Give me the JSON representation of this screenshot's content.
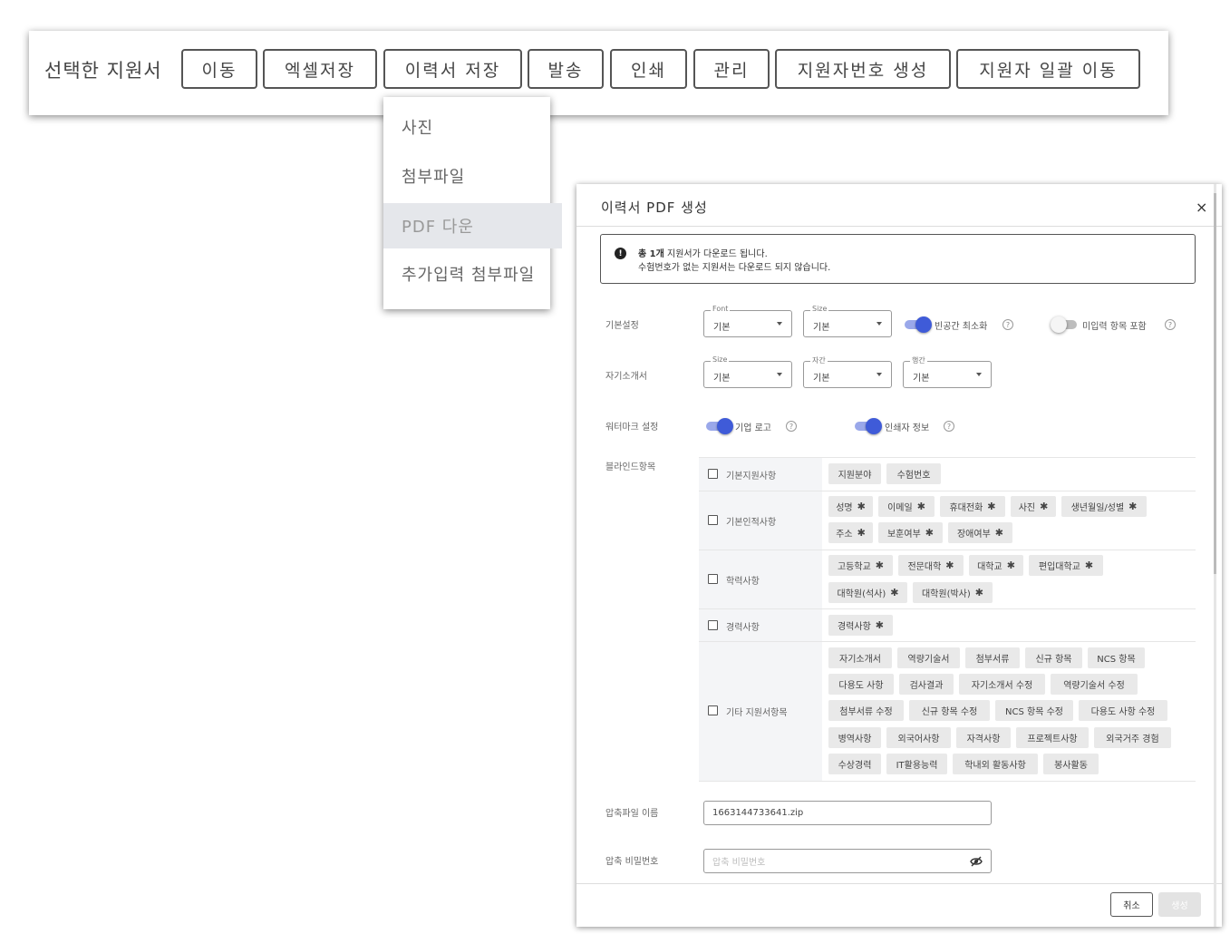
{
  "toolbar": {
    "title": "선택한 지원서",
    "buttons": [
      "이동",
      "엑셀저장",
      "이력서 저장",
      "발송",
      "인쇄",
      "관리",
      "지원자번호 생성",
      "지원자 일괄 이동"
    ]
  },
  "dropdown": {
    "items": [
      "사진",
      "첨부파일",
      "PDF 다운",
      "추가입력 첨부파일"
    ],
    "active_item": "PDF 다운"
  },
  "modal": {
    "title": "이력서 PDF 생성",
    "close": "×",
    "notice": {
      "icon": "info-icon",
      "line1_bold": "총 1개",
      "line1_rest": " 지원서가 다운로드 됩니다.",
      "line2": "수험번호가 없는 지원서는 다운로드 되지 않습니다."
    },
    "basic": {
      "label": "기본설정",
      "font": {
        "legend": "Font",
        "value": "기본"
      },
      "size": {
        "legend": "Size",
        "value": "기본"
      },
      "toggle1": {
        "label": "빈공간 최소화",
        "on": true
      },
      "toggle2": {
        "label": "미입력 항목 포함",
        "on": false
      }
    },
    "intro": {
      "label": "자기소개서",
      "size": {
        "legend": "Size",
        "value": "기본"
      },
      "spacing": {
        "legend": "자간",
        "value": "기본"
      },
      "line": {
        "legend": "행간",
        "value": "기본"
      }
    },
    "watermark": {
      "label": "워터마크 설정",
      "toggle1": {
        "label": "기업 로고",
        "on": true
      },
      "toggle2": {
        "label": "인쇄자 정보",
        "on": true
      }
    },
    "blind": {
      "label": "블라인드항목",
      "rows": [
        {
          "label": "기본지원사항",
          "chips": [
            "지원분야",
            "수험번호"
          ]
        },
        {
          "label": "기본인적사항",
          "chips": [
            "성명",
            "이메일",
            "휴대전화",
            "사진",
            "생년월일/성별",
            "주소",
            "보훈여부",
            "장애여부"
          ]
        },
        {
          "label": "학력사항",
          "chips": [
            "고등학교",
            "전문대학",
            "대학교",
            "편입대학교",
            "대학원(석사)",
            "대학원(박사)"
          ]
        },
        {
          "label": "경력사항",
          "chips": [
            "경력사항"
          ]
        },
        {
          "label": "기타 지원서항목",
          "chips": [
            "자기소개서",
            "역량기술서",
            "첨부서류",
            "신규 항목",
            "NCS 항목",
            "다용도 사항",
            "검사결과",
            "자기소개서 수정",
            "역량기술서 수정",
            "첨부서류 수정",
            "신규 항목 수정",
            "NCS 항목 수정",
            "다용도 사항 수정",
            "병역사항",
            "외국어사항",
            "자격사항",
            "프로젝트사항",
            "외국거주 경험",
            "수상경력",
            "IT활용능력",
            "학내외 활동사항",
            "봉사활동"
          ]
        }
      ]
    },
    "zip_name": {
      "label": "압축파일 이름",
      "value": "1663144733641.zip"
    },
    "zip_password": {
      "label": "압축 비밀번호",
      "placeholder": "압축 비밀번호",
      "icon": "eye-off-icon"
    },
    "footer": {
      "cancel": "취소",
      "create": "생성"
    },
    "colors": {
      "accent": "#3f5bd8",
      "chip_bg": "#e9e9e9",
      "active_menu_bg": "#e5e7eb"
    }
  }
}
